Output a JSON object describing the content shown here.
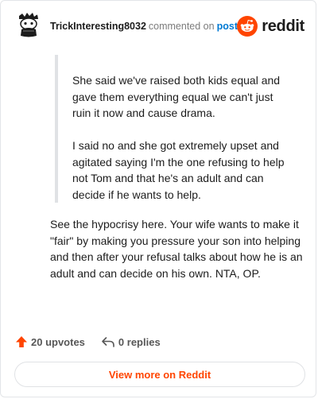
{
  "header": {
    "username": "TrickInteresting8032",
    "commented_on": "commented on",
    "post_link": "post",
    "brand": "reddit",
    "avatar_icon": "snoo-avatar-icon",
    "brand_icon": "reddit-logo-icon"
  },
  "quote": {
    "paragraphs": [
      "She said we've raised both kids equal and gave them everything equal we can't just ruin it now and cause drama.",
      "I said no and she got extremely upset and agitated saying I'm the one refusing to help not Tom and that he's an adult and can decide if he wants to help."
    ]
  },
  "comment": {
    "body": "See the hypocrisy here. Your wife wants to make it \"fair\" by making you pressure your son into helping and then after your refusal talks about how he is an adult and can decide on his own. NTA, OP."
  },
  "footer": {
    "upvotes": "20 upvotes",
    "replies": "0 replies",
    "upvote_icon": "upvote-arrow-icon",
    "reply_icon": "reply-arrow-icon"
  },
  "view_more_label": "View more on Reddit",
  "colors": {
    "accent": "#ff4500",
    "link": "#0079d3",
    "text": "#1c1c1c",
    "muted": "#575757",
    "border": "#e0e2e5"
  }
}
